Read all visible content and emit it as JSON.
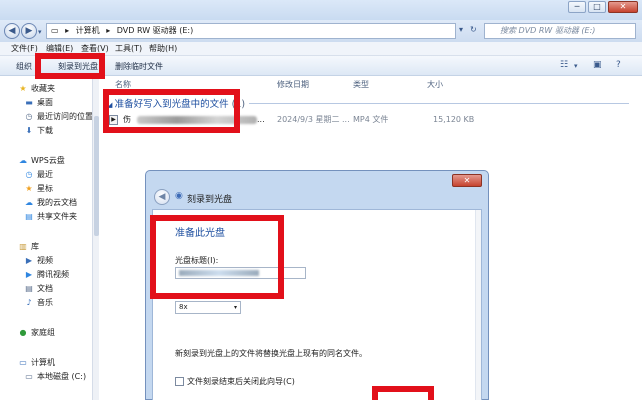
{
  "title_bar": {
    "minimize": "─",
    "maximize": "□",
    "close": "✕"
  },
  "address": {
    "back": "◀",
    "forward": "▶",
    "dropdown": "▾",
    "path": [
      "▸",
      "计算机",
      "▸",
      "DVD RW 驱动器 (E:)"
    ],
    "path_dropdown": "▾",
    "refresh": "↻",
    "search_placeholder": "搜索 DVD RW 驱动器 (E:)"
  },
  "menubar": {
    "items": [
      "文件(F)",
      "编辑(E)",
      "查看(V)",
      "工具(T)",
      "帮助(H)"
    ]
  },
  "toolbar": {
    "organize": "组织",
    "burn": "刻录到光盘",
    "delete_temp": "删除临时文件",
    "view_icon": "☷",
    "view_dropdown": "▾",
    "preview_icon": "▣",
    "help_icon": "?"
  },
  "navigation": {
    "favorites": {
      "label": "收藏夹",
      "items": [
        "桌面",
        "最近访问的位置",
        "下载"
      ]
    },
    "wps": {
      "label": "WPS云盘",
      "items": [
        "最近",
        "星标",
        "我的云文档",
        "共享文件夹"
      ]
    },
    "library": {
      "label": "库",
      "items": [
        "视频",
        "腾讯视频",
        "文档",
        "音乐"
      ]
    },
    "homegroup": {
      "label": "家庭组"
    },
    "computer": {
      "label": "计算机",
      "items": [
        "本地磁盘 (C:)"
      ]
    }
  },
  "columns": {
    "name": "名称",
    "modified": "修改日期",
    "type": "类型",
    "size": "大小"
  },
  "group": {
    "label": "准备好写入到光盘中的文件",
    "count": "(1)"
  },
  "files": [
    {
      "name_prefix": "伤",
      "name_suffix": "...",
      "modified": "2024/9/3 星期二 ...",
      "type": "MP4 文件",
      "size": "15,120 KB"
    }
  ],
  "dialog": {
    "heading": "刻录到光盘",
    "close": "✕",
    "subtitle": "准备此光盘",
    "disc_title_label": "光盘标题(I):",
    "speed_value": "8x",
    "speed_arrow": "▾",
    "note": "新刻录到光盘上的文件将替换光盘上现有的同名文件。",
    "checkbox_label": "文件刻录结束后关闭此向导(C)"
  },
  "icons": {
    "favorites": "★",
    "desktop": "▬",
    "recent": "◷",
    "download": "⬇",
    "cloud": "☁",
    "recent_cloud": "◷",
    "star": "★",
    "cloud_doc": "☁",
    "shared": "▤",
    "library": "▥",
    "video": "▶",
    "tencent_video": "▶",
    "document": "▤",
    "music": "♪",
    "homegroup": "●",
    "computer": "▭",
    "disk": "▭",
    "disc": "◉"
  },
  "colors": {
    "highlight": "#e2101a",
    "link": "#1e4fa0"
  }
}
